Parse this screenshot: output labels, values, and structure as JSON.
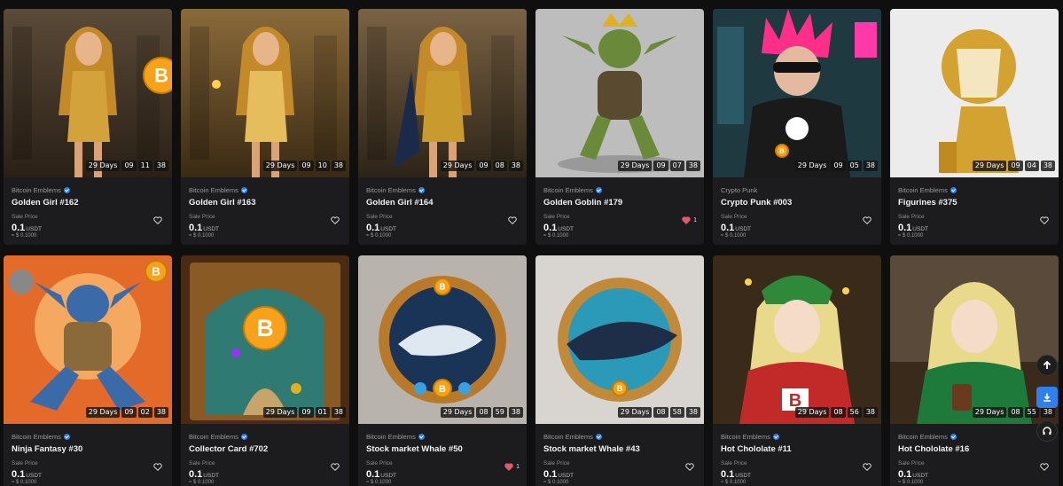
{
  "currency": "USDT",
  "sale_label": "Sale Price",
  "cards": [
    {
      "collection": "Bitcoin Emblems",
      "verified": true,
      "name": "Golden Girl #162",
      "days": "29 Days",
      "h": "09",
      "m": "11",
      "s": "38",
      "price": "0.1",
      "usd": "≈ $ 0.1000",
      "liked": false,
      "likes": "",
      "art": "girl-gold-1"
    },
    {
      "collection": "Bitcoin Emblems",
      "verified": true,
      "name": "Golden Girl #163",
      "days": "29 Days",
      "h": "09",
      "m": "10",
      "s": "38",
      "price": "0.1",
      "usd": "≈ $ 0.1000",
      "liked": false,
      "likes": "",
      "art": "girl-gold-2"
    },
    {
      "collection": "Bitcoin Emblems",
      "verified": true,
      "name": "Golden Girl #164",
      "days": "29 Days",
      "h": "09",
      "m": "08",
      "s": "38",
      "price": "0.1",
      "usd": "≈ $ 0.1000",
      "liked": false,
      "likes": "",
      "art": "girl-gold-3"
    },
    {
      "collection": "Bitcoin Emblems",
      "verified": true,
      "name": "Golden Goblin #179",
      "days": "29 Days",
      "h": "09",
      "m": "07",
      "s": "38",
      "price": "0.1",
      "usd": "≈ $ 0.1000",
      "liked": true,
      "likes": "1",
      "art": "goblin"
    },
    {
      "collection": "Crypto Punk",
      "verified": false,
      "name": "Crypto Punk #003",
      "days": "29 Days",
      "h": "09",
      "m": "05",
      "s": "38",
      "price": "0.1",
      "usd": "≈ $ 0.1000",
      "liked": false,
      "likes": "",
      "art": "punk"
    },
    {
      "collection": "Bitcoin Emblems",
      "verified": true,
      "name": "Figurines #375",
      "days": "29 Days",
      "h": "09",
      "m": "04",
      "s": "38",
      "price": "0.1",
      "usd": "≈ $ 0.1000",
      "liked": false,
      "likes": "",
      "art": "lion"
    },
    {
      "collection": "Bitcoin Emblems",
      "verified": true,
      "name": "Ninja Fantasy #30",
      "days": "29 Days",
      "h": "09",
      "m": "02",
      "s": "38",
      "price": "0.1",
      "usd": "≈ $ 0.1000",
      "liked": false,
      "likes": "",
      "art": "ninja"
    },
    {
      "collection": "Bitcoin Emblems",
      "verified": true,
      "name": "Collector Card #702",
      "days": "29 Days",
      "h": "09",
      "m": "01",
      "s": "38",
      "price": "0.1",
      "usd": "≈ $ 0.1000",
      "liked": false,
      "likes": "",
      "art": "card"
    },
    {
      "collection": "Bitcoin Emblems",
      "verified": true,
      "name": "Stock market Whale #50",
      "days": "29 Days",
      "h": "08",
      "m": "59",
      "s": "38",
      "price": "0.1",
      "usd": "≈ $ 0.1000",
      "liked": true,
      "likes": "1",
      "art": "whale-1"
    },
    {
      "collection": "Bitcoin Emblems",
      "verified": true,
      "name": "Stock market Whale #43",
      "days": "29 Days",
      "h": "08",
      "m": "58",
      "s": "38",
      "price": "0.1",
      "usd": "≈ $ 0.1000",
      "liked": false,
      "likes": "",
      "art": "whale-2"
    },
    {
      "collection": "Bitcoin Emblems",
      "verified": true,
      "name": "Hot Chololate #11",
      "days": "29 Days",
      "h": "08",
      "m": "56",
      "s": "38",
      "price": "0.1",
      "usd": "≈ $ 0.1000",
      "liked": false,
      "likes": "",
      "art": "anime-1"
    },
    {
      "collection": "Bitcoin Emblems",
      "verified": true,
      "name": "Hot Chololate #16",
      "days": "29 Days",
      "h": "08",
      "m": "55",
      "s": "38",
      "price": "0.1",
      "usd": "≈ $ 0.1000",
      "liked": false,
      "likes": "",
      "art": "anime-2"
    }
  ],
  "floating": [
    {
      "icon": "arrow-up-icon",
      "color": "#ffffff",
      "bg": "#1e1e1e"
    },
    {
      "icon": "download-icon",
      "color": "#ffffff",
      "bg": "#2f80ed"
    },
    {
      "icon": "headphones-icon",
      "color": "#ffffff",
      "bg": "#1e1e1e"
    }
  ]
}
